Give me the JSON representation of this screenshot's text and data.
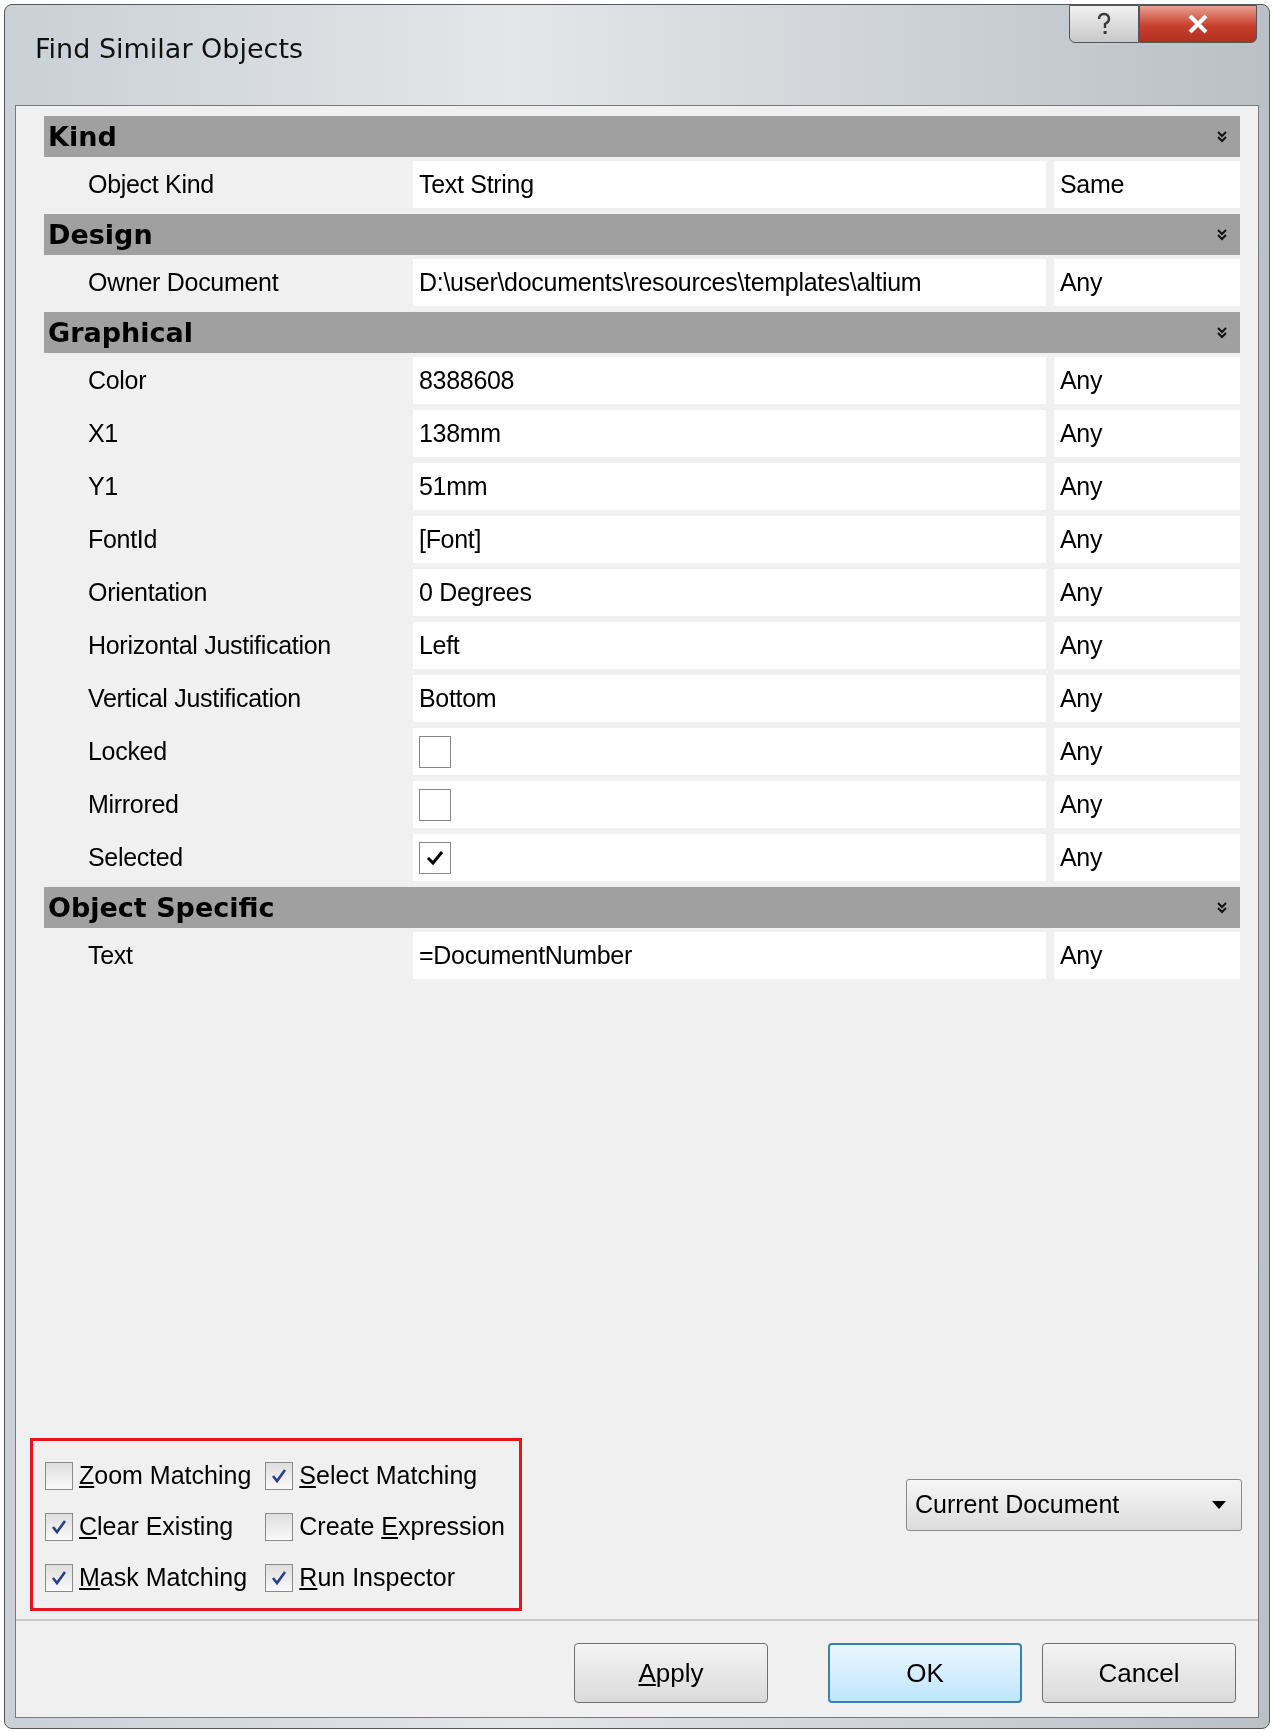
{
  "window": {
    "title": "Find Similar Objects"
  },
  "sections": [
    {
      "title": "Kind",
      "expanded": true,
      "rows": [
        {
          "kind": "text",
          "label": "Object Kind",
          "value": "Text String",
          "match": "Same"
        }
      ]
    },
    {
      "title": "Design",
      "expanded": true,
      "rows": [
        {
          "kind": "text",
          "label": "Owner Document",
          "value": "D:\\user\\documents\\resources\\templates\\altium",
          "match": "Any"
        }
      ]
    },
    {
      "title": "Graphical",
      "expanded": true,
      "rows": [
        {
          "kind": "text",
          "label": "Color",
          "value": "8388608",
          "match": "Any"
        },
        {
          "kind": "text",
          "label": "X1",
          "value": "138mm",
          "match": "Any"
        },
        {
          "kind": "text",
          "label": "Y1",
          "value": "51mm",
          "match": "Any"
        },
        {
          "kind": "text",
          "label": "FontId",
          "value": "[Font]",
          "match": "Any"
        },
        {
          "kind": "text",
          "label": "Orientation",
          "value": "0 Degrees",
          "match": "Any"
        },
        {
          "kind": "text",
          "label": "Horizontal Justification",
          "value": "Left",
          "match": "Any"
        },
        {
          "kind": "text",
          "label": "Vertical Justification",
          "value": "Bottom",
          "match": "Any"
        },
        {
          "kind": "checkbox",
          "label": "Locked",
          "checked": false,
          "match": "Any"
        },
        {
          "kind": "checkbox",
          "label": "Mirrored",
          "checked": false,
          "match": "Any"
        },
        {
          "kind": "checkbox",
          "label": "Selected",
          "checked": true,
          "match": "Any"
        }
      ]
    },
    {
      "title": "Object Specific",
      "expanded": true,
      "rows": [
        {
          "kind": "text",
          "label": "Text",
          "value": "=DocumentNumber",
          "match": "Any"
        }
      ]
    }
  ],
  "options": {
    "highlighted": true,
    "items": [
      {
        "label": {
          "access_key": "Z",
          "after": "oom Matching"
        },
        "checked": false
      },
      {
        "label": {
          "access_key": "S",
          "after": "elect Matching"
        },
        "checked": true
      },
      {
        "label": {
          "access_key": "C",
          "after": "lear Existing"
        },
        "checked": true
      },
      {
        "label": {
          "before": "Create ",
          "access_key": "E",
          "after": "xpression"
        },
        "checked": false
      },
      {
        "label": {
          "access_key": "M",
          "after": "ask Matching"
        },
        "checked": true
      },
      {
        "label": {
          "access_key": "R",
          "after": "un Inspector"
        },
        "checked": true
      }
    ]
  },
  "scope": {
    "value": "Current Document"
  },
  "buttons": [
    {
      "label": {
        "access_key": "A",
        "after": "pply"
      },
      "default": false
    },
    {
      "label": {
        "before": "OK"
      },
      "default": true
    },
    {
      "label": {
        "before": "Cancel"
      },
      "default": false
    }
  ]
}
